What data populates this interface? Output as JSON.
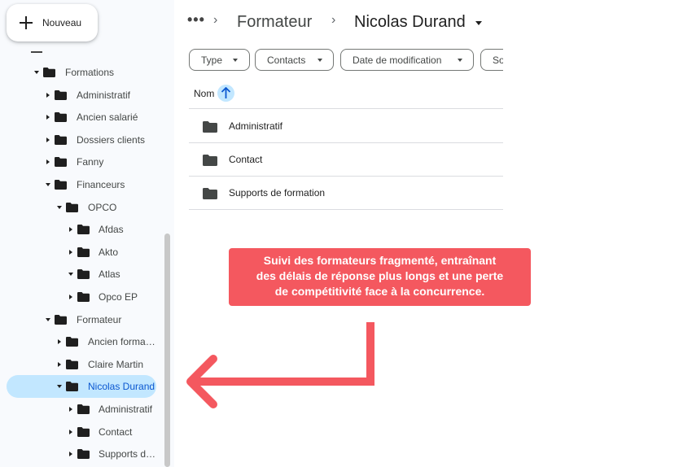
{
  "new_button": {
    "label": "Nouveau",
    "icon": "plus-icon"
  },
  "sidebar": {
    "tree": [
      {
        "label": "Formations",
        "expanded": true,
        "depth": 0
      },
      {
        "label": "Administratif",
        "expanded": false,
        "depth": 1
      },
      {
        "label": "Ancien salarié",
        "expanded": false,
        "depth": 1
      },
      {
        "label": "Dossiers clients",
        "expanded": false,
        "depth": 1
      },
      {
        "label": "Fanny",
        "expanded": false,
        "depth": 1
      },
      {
        "label": "Financeurs",
        "expanded": true,
        "depth": 1
      },
      {
        "label": "OPCO",
        "expanded": true,
        "depth": 2
      },
      {
        "label": "Afdas",
        "expanded": false,
        "depth": 3
      },
      {
        "label": "Akto",
        "expanded": false,
        "depth": 3
      },
      {
        "label": "Atlas",
        "expanded": true,
        "depth": 3
      },
      {
        "label": "Opco EP",
        "expanded": false,
        "depth": 3
      },
      {
        "label": "Formateur",
        "expanded": true,
        "depth": 1
      },
      {
        "label": "Ancien forma…",
        "expanded": false,
        "depth": 2
      },
      {
        "label": "Claire Martin",
        "expanded": false,
        "depth": 2
      },
      {
        "label": "Nicolas Durand",
        "expanded": true,
        "depth": 2,
        "selected": true
      },
      {
        "label": "Administratif",
        "expanded": false,
        "depth": 3
      },
      {
        "label": "Contact",
        "expanded": false,
        "depth": 3
      },
      {
        "label": "Supports d…",
        "expanded": false,
        "depth": 3
      }
    ]
  },
  "breadcrumb": {
    "more": "•••",
    "separator": "›",
    "parent": "Formateur",
    "current": "Nicolas Durand"
  },
  "filters": [
    "Type",
    "Contacts",
    "Date de modification",
    "So"
  ],
  "list": {
    "header": "Nom",
    "sort_icon": "arrow-up-icon",
    "items": [
      "Administratif",
      "Contact",
      "Supports de formation"
    ]
  },
  "annotation": {
    "text_lines": [
      "Suivi des formateurs fragmenté, entraînant",
      "des délais de réponse plus longs et une perte",
      "de compétitivité face à la concurrence."
    ],
    "color": "#f4585f"
  },
  "colors": {
    "selected_bg": "#c2e7ff",
    "sidebar_bg": "#f8fafd",
    "accent": "#0b57d0"
  }
}
